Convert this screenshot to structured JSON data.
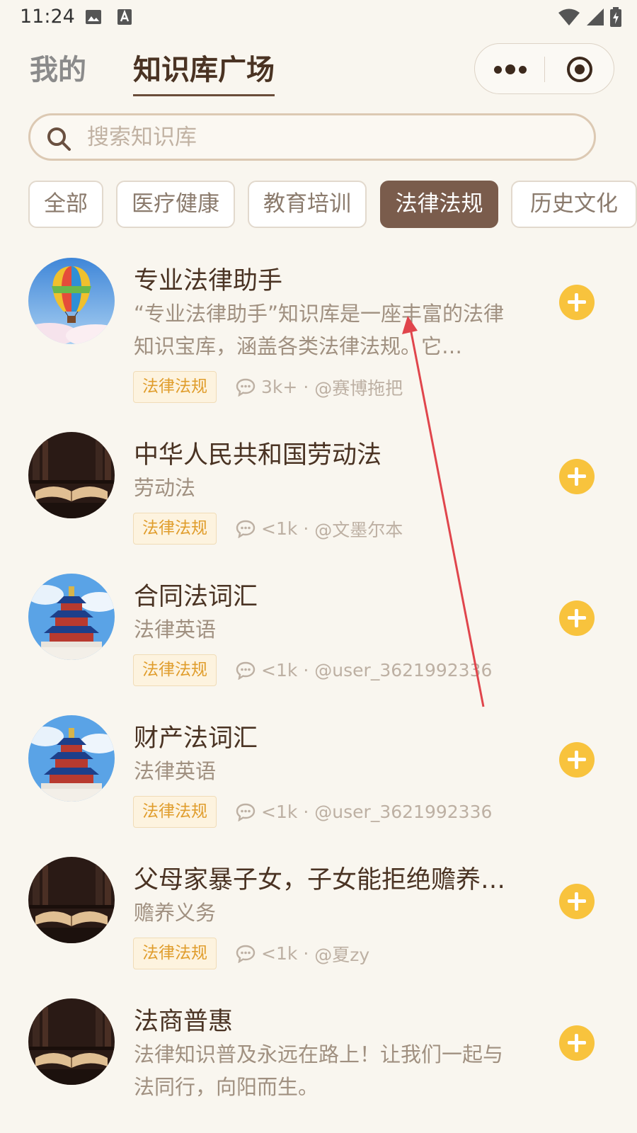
{
  "status_bar": {
    "time": "11:24"
  },
  "header": {
    "tab_mine": "我的",
    "tab_square": "知识库广场",
    "capsule_more_icon": "more-dots-icon",
    "capsule_close_icon": "target-circle-icon"
  },
  "search": {
    "placeholder": "搜索知识库",
    "value": ""
  },
  "categories": {
    "items": [
      "全部",
      "医疗健康",
      "教育培训",
      "法律法规",
      "历史文化"
    ],
    "selected": "法律法规"
  },
  "list": [
    {
      "title": "专业法律助手",
      "description": "“专业法律助手”知识库是一座丰富的法律知识宝库，涵盖各类法律法规。它…",
      "tag": "法律法规",
      "count": "3k+",
      "author": "@赛博拖把",
      "avatar": "hot-air-balloon"
    },
    {
      "title": "中华人民共和国劳动法",
      "description": "劳动法",
      "tag": "法律法规",
      "count": "<1k",
      "author": "@文墨尔本",
      "avatar": "open-book"
    },
    {
      "title": "合同法词汇",
      "description": "法律英语",
      "tag": "法律法规",
      "count": "<1k",
      "author": "@user_3621992336",
      "avatar": "temple-of-heaven"
    },
    {
      "title": "财产法词汇",
      "description": "法律英语",
      "tag": "法律法规",
      "count": "<1k",
      "author": "@user_3621992336",
      "avatar": "temple-of-heaven"
    },
    {
      "title": "父母家暴子女，子女能拒绝赡养…",
      "description": "赡养义务",
      "tag": "法律法规",
      "count": "<1k",
      "author": "@夏zy",
      "avatar": "open-book"
    },
    {
      "title": "法商普惠",
      "description": "法律知识普及永远在路上！让我们一起与法同行，向阳而生。",
      "tag": "",
      "count": "",
      "author": "",
      "avatar": "open-book"
    }
  ],
  "colors": {
    "background": "#f9f6ef",
    "active_chip": "#7a5c4c",
    "tag_text": "#e09d2c",
    "add_button": "#f8c33d",
    "annotation_arrow": "#e0454c"
  }
}
